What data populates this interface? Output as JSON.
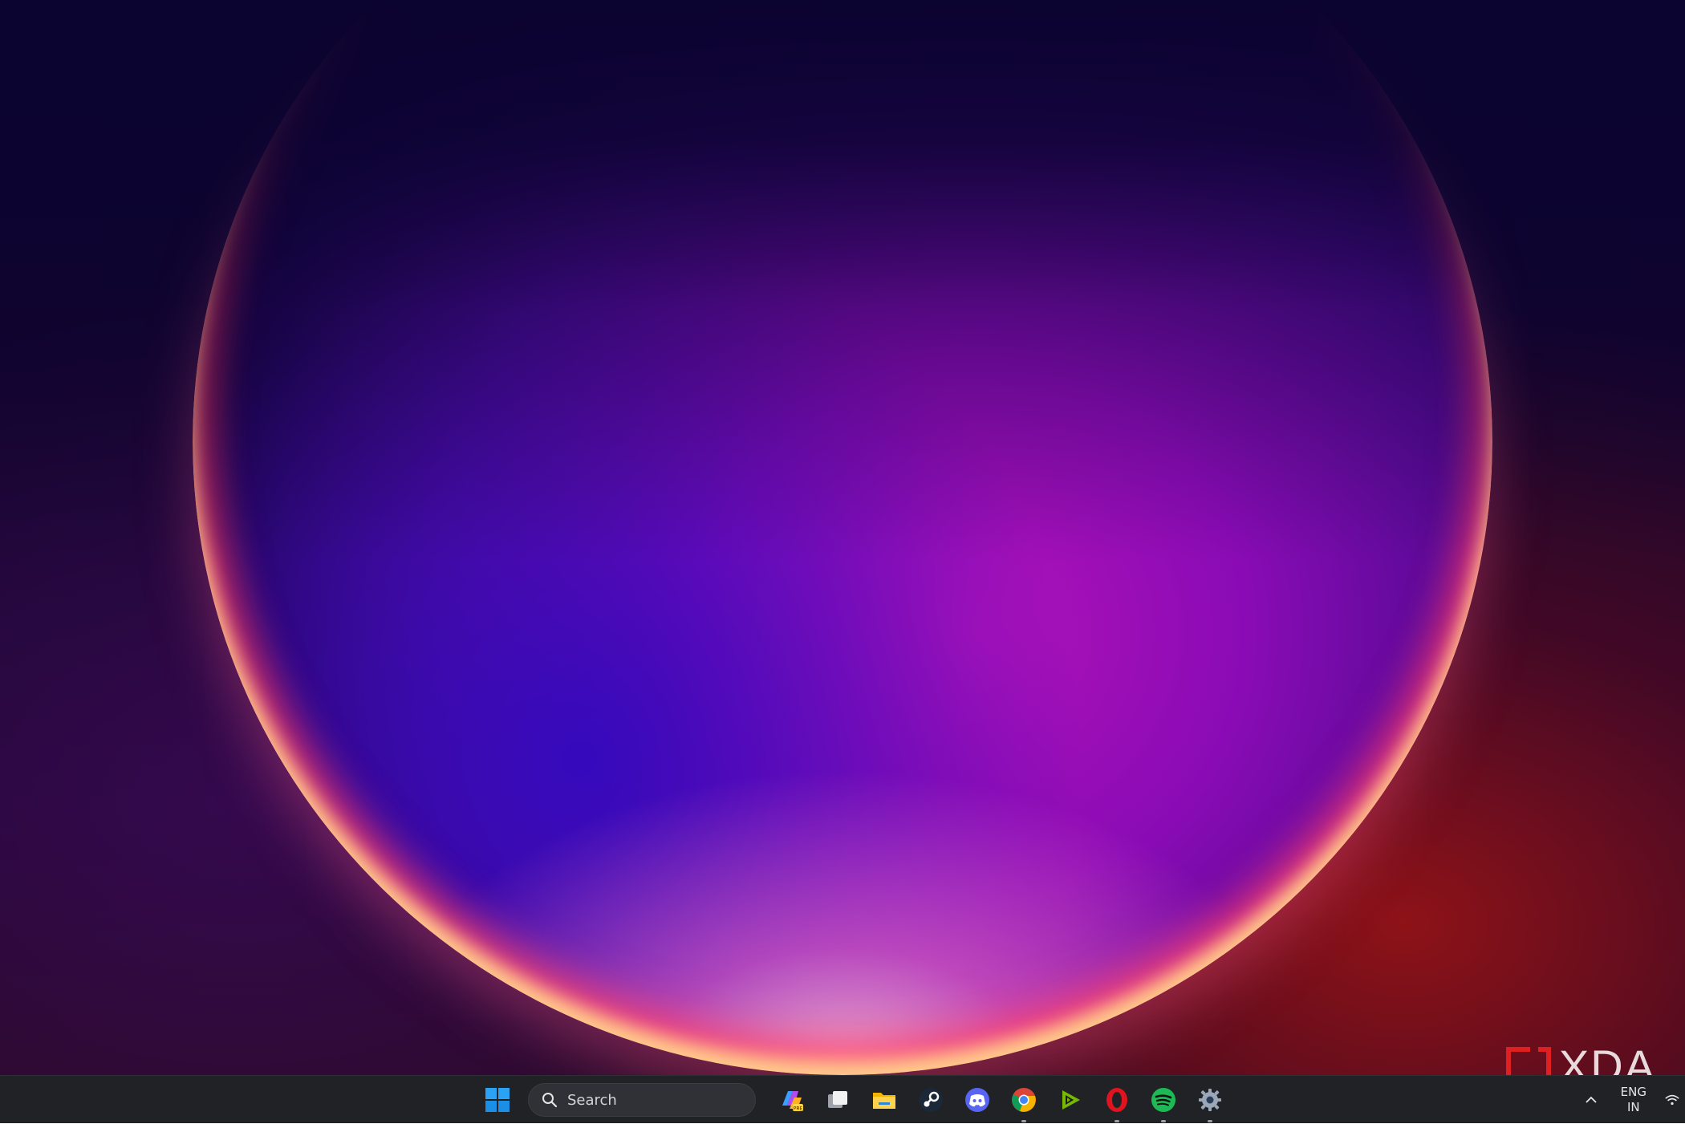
{
  "taskbar": {
    "search_placeholder": "Search",
    "apps": [
      {
        "name": "copilot-icon",
        "running": false
      },
      {
        "name": "task-view-icon",
        "running": false
      },
      {
        "name": "file-explorer-icon",
        "running": false
      },
      {
        "name": "steam-icon",
        "running": false
      },
      {
        "name": "discord-icon",
        "running": false
      },
      {
        "name": "chrome-icon",
        "running": true
      },
      {
        "name": "nvidia-icon",
        "running": false
      },
      {
        "name": "opera-icon",
        "running": true
      },
      {
        "name": "spotify-icon",
        "running": true
      },
      {
        "name": "settings-icon",
        "running": true
      }
    ],
    "tray": {
      "language_line1": "ENG",
      "language_line2": "IN"
    }
  },
  "watermark": {
    "text": "XDA"
  },
  "colors": {
    "taskbar_bg": "#202226",
    "accent_blue": "#0078d4",
    "spotify_green": "#1db954",
    "opera_red": "#e0141e",
    "discord_blurple": "#5865f2"
  }
}
